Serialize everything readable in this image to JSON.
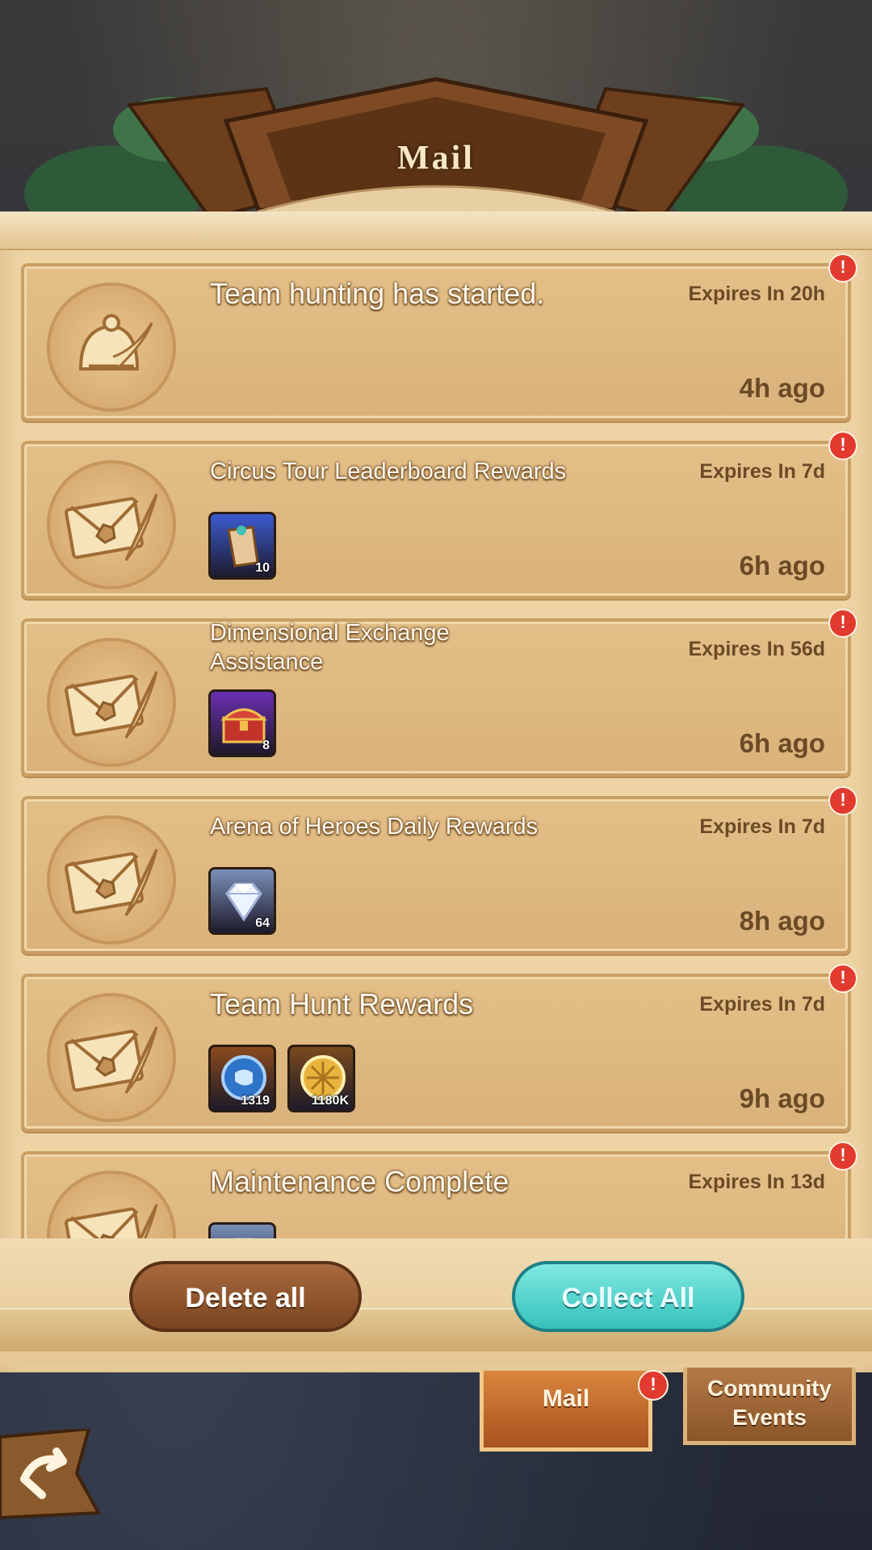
{
  "header": {
    "title": "Mail"
  },
  "mails": [
    {
      "title": "Team hunting has started.",
      "expires": "Expires In 20h",
      "ago": "4h ago",
      "icon": "bell-feather-icon",
      "items": []
    },
    {
      "title": "Circus Tour Leaderboard Rewards",
      "expires": "Expires In 7d",
      "ago": "6h ago",
      "icon": "envelope-quill-icon",
      "items": [
        {
          "icon": "scroll-icon",
          "qty": "10",
          "color": "#3b5bd0"
        }
      ]
    },
    {
      "title": "Dimensional Exchange Assistance",
      "expires": "Expires In 56d",
      "ago": "6h ago",
      "icon": "envelope-quill-icon",
      "items": [
        {
          "icon": "treasure-chest-icon",
          "qty": "8",
          "color": "#6a2fb1"
        }
      ]
    },
    {
      "title": "Arena of Heroes Daily Rewards",
      "expires": "Expires In 7d",
      "ago": "8h ago",
      "icon": "envelope-quill-icon",
      "items": [
        {
          "icon": "diamond-icon",
          "qty": "64",
          "color": "#7a8fb8"
        }
      ]
    },
    {
      "title": "Team Hunt Rewards",
      "expires": "Expires In 7d",
      "ago": "9h ago",
      "icon": "envelope-quill-icon",
      "items": [
        {
          "icon": "fist-token-icon",
          "qty": "1319",
          "color": "#8a4a1c"
        },
        {
          "icon": "gold-coin-icon",
          "qty": "1180K",
          "color": "#7a4a1c"
        }
      ]
    },
    {
      "title": "Maintenance Complete",
      "expires": "Expires In 13d",
      "ago": "",
      "icon": "envelope-quill-icon",
      "items": [
        {
          "icon": "diamond-icon",
          "qty": "",
          "color": "#7a8fb8"
        }
      ]
    }
  ],
  "badge_symbol": "!",
  "buttons": {
    "delete_label": "Delete all",
    "collect_label": "Collect All"
  },
  "tabs": {
    "mail_label": "Mail",
    "community_line1": "Community",
    "community_line2": "Events"
  },
  "colors": {
    "panel": "#eed4a4",
    "card": "#dcb57d",
    "collect": "#4fd3cf",
    "delete": "#8e5530",
    "badge": "#e23a2e"
  }
}
